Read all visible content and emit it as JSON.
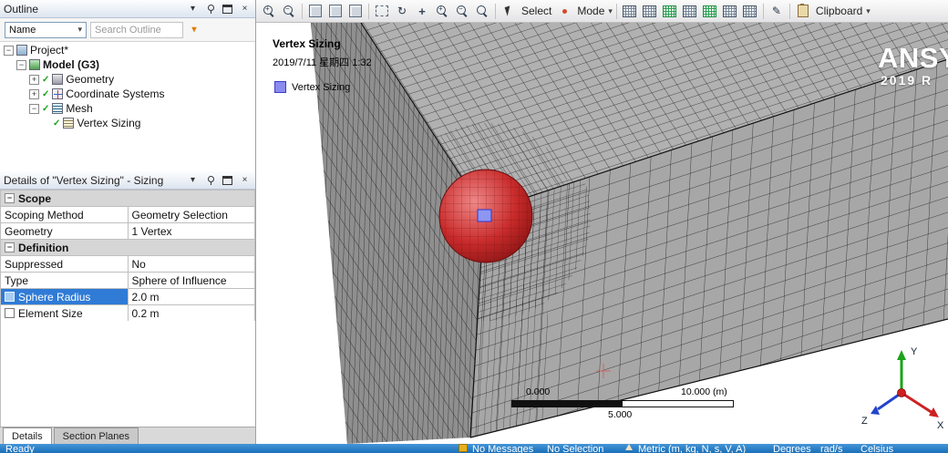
{
  "outline": {
    "title": "Outline",
    "filter_label": "Name",
    "search_placeholder": "Search Outline",
    "tree": [
      {
        "label": "Project*"
      },
      {
        "label": "Model (G3)"
      },
      {
        "label": "Geometry"
      },
      {
        "label": "Coordinate Systems"
      },
      {
        "label": "Mesh"
      },
      {
        "label": "Vertex Sizing"
      }
    ]
  },
  "details": {
    "title": "Details of \"Vertex Sizing\" - Sizing",
    "rows": [
      {
        "label": "Scope"
      },
      {
        "label": "Scoping Method",
        "value": "Geometry Selection"
      },
      {
        "label": "Geometry",
        "value": "1 Vertex"
      },
      {
        "label": "Definition"
      },
      {
        "label": "Suppressed",
        "value": "No"
      },
      {
        "label": "Type",
        "value": "Sphere of Influence"
      },
      {
        "label": "Sphere Radius",
        "value": "2.0 m"
      },
      {
        "label": "Element Size",
        "value": "0.2 m"
      }
    ]
  },
  "tabs": {
    "details": "Details",
    "section_planes": "Section Planes"
  },
  "viewport_toolbar": {
    "select_label": "Select",
    "mode_label": "Mode",
    "clipboard_label": "Clipboard"
  },
  "viewport": {
    "annotation_title": "Vertex Sizing",
    "annotation_date": "2019/7/11 星期四 1:32",
    "legend_label": "Vertex Sizing",
    "logo_line1": "ANSYS",
    "logo_line2": "2019 R",
    "ruler_start": "0.000",
    "ruler_mid": "5.000",
    "ruler_end": "10.000 (m)",
    "triad_x": "X",
    "triad_y": "Y",
    "triad_z": "Z"
  },
  "statusbar": {
    "left": "Ready",
    "messages": "No Messages",
    "selection": "No Selection",
    "units": "Metric (m, kg, N, s, V, A)",
    "angle": "Degrees",
    "rotational_velocity": "rad/s",
    "temperature": "Celsius"
  },
  "glyphs": {
    "chevron_down": "▾",
    "close": "×",
    "check": "✓",
    "plus": "+",
    "minus": "−",
    "rotate": "↻",
    "pencil": "✎"
  }
}
